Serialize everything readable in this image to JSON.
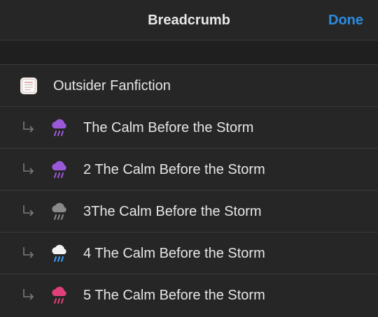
{
  "header": {
    "title": "Breadcrumb",
    "done_label": "Done"
  },
  "items": [
    {
      "label": "Outsider Fanfiction",
      "level": 0,
      "icon": "sheet-icon"
    },
    {
      "label": "The Calm Before the Storm",
      "level": 1,
      "icon": "rain-cloud-icon",
      "icon_color": "#9b59d9"
    },
    {
      "label": "2 The Calm Before the Storm",
      "level": 1,
      "icon": "rain-cloud-icon",
      "icon_color": "#9b59d9"
    },
    {
      "label": "3The Calm Before the Storm",
      "level": 1,
      "icon": "rain-cloud-icon",
      "icon_color": "#8a8a8a"
    },
    {
      "label": "4 The Calm Before the Storm",
      "level": 1,
      "icon": "rain-cloud-icon",
      "icon_color": "#f2f2f2",
      "drop_color": "#3aa0ff"
    },
    {
      "label": "5 The Calm Before the Storm",
      "level": 1,
      "icon": "rain-cloud-icon",
      "icon_color": "#e0407a"
    }
  ],
  "colors": {
    "background": "#262626",
    "spacer": "#1f1f1f",
    "separator": "#3a3a3a",
    "accent": "#2b8ce0"
  }
}
